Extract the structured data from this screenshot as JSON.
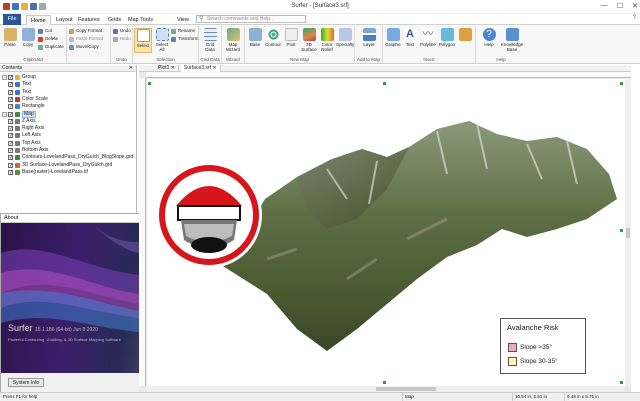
{
  "window": {
    "title": "Surfer - [Surface3.srf]",
    "min": "—",
    "max": "☐",
    "close": "✕"
  },
  "tabs": [
    "File",
    "Home",
    "Layout",
    "Features",
    "Grids",
    "Map Tools",
    "View"
  ],
  "search_placeholder": "Search commands and Help...",
  "ribbon": {
    "groups": {
      "clipboard": "Clipboard",
      "undo": "Undo",
      "selection": "Selection",
      "grid_data": "Grid Data",
      "wizard": "Wizard",
      "new_map": "New Map",
      "add_to_map": "Add to Map",
      "insert": "Insert",
      "help": "Help"
    },
    "paste": "Paste",
    "copy": "Copy",
    "cut": "Cut",
    "delete": "Delete",
    "duplicate": "Duplicate",
    "copy_format": "Copy Format",
    "paste_format": "Paste Format",
    "move_copy": "Move/Copy",
    "undo": "Undo",
    "redo": "Redo",
    "select": "Select",
    "select_all": "Select All",
    "rename": "Rename",
    "transform": "Transform",
    "grid_data_btn": "Grid Data",
    "map_wizard": "Map Wizard",
    "base": "Base",
    "contour": "Contour",
    "post": "Post",
    "surface_3d": "3D Surface",
    "color_relief": "Color Relief",
    "specialty": "Specialty",
    "layer": "Layer",
    "graphic": "Graphic",
    "text": "Text",
    "polyline": "Polyline",
    "polygon": "Polygon",
    "help_btn": "Help",
    "knowledge_base": "Knowledge Base"
  },
  "contents": {
    "title": "Contents",
    "close": "✕",
    "items": [
      {
        "label": "Group",
        "level": 0
      },
      {
        "label": "Text",
        "level": 1
      },
      {
        "label": "Text",
        "level": 1
      },
      {
        "label": "Color Scale",
        "level": 1
      },
      {
        "label": "Rectangle",
        "level": 1
      },
      {
        "label": "Map",
        "level": 0
      },
      {
        "label": "Z Axis",
        "level": 1
      },
      {
        "label": "Right Axis",
        "level": 1
      },
      {
        "label": "Left Axis",
        "level": 1
      },
      {
        "label": "Top Axis",
        "level": 1
      },
      {
        "label": "Bottom Axis",
        "level": 1
      },
      {
        "label": "Contours-LovelandPass_DryGulch_BlogSlope.grd",
        "level": 1
      },
      {
        "label": "3D Surface-LovelandPass_DryGulch.grd",
        "level": 1
      },
      {
        "label": "Base(raster)-LovelandPass.tif",
        "level": 1
      }
    ]
  },
  "doc_tabs": [
    "Plot1",
    "Surface3.srf"
  ],
  "legend": {
    "title": "Avalanche Risk",
    "items": [
      {
        "label": "Slope >35°",
        "color": "#f4a8b6"
      },
      {
        "label": "Slope 30-35°",
        "color": "#fbf5b4"
      }
    ]
  },
  "about": {
    "title": "About",
    "close": "✕",
    "product": "Surfer",
    "version": "16.1.186 (64-bit) Jun 8 2020",
    "tagline": "Powerful Contouring, Gridding, & 3D Surface Mapping Software",
    "btn_system_info": "System Info",
    "btn_ok": "OK"
  },
  "status": {
    "help": "Press F1 for help",
    "object": "Map",
    "coords": "10.54 in, 5.51 in",
    "size": "9.48 in x 5.75 in"
  },
  "colors": {
    "accent": "#2b579a",
    "logo_red": "#d7161c"
  }
}
